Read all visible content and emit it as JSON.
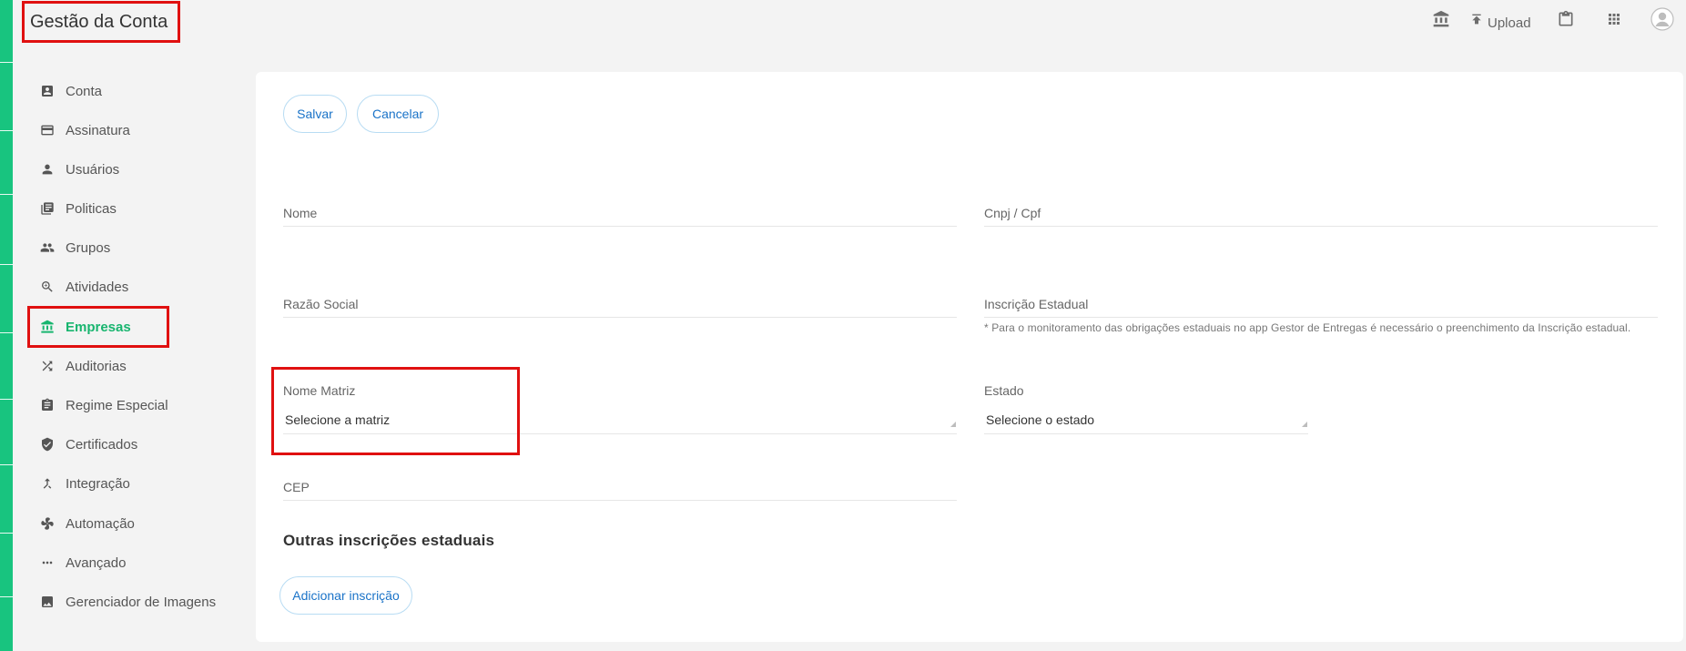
{
  "header": {
    "title": "Gestão da Conta",
    "upload_label": "Upload",
    "icons": [
      "bank-icon",
      "upload-icon",
      "clipboard-icon",
      "apps-icon",
      "avatar-icon"
    ]
  },
  "sidebar": {
    "items": [
      {
        "label": "Conta",
        "icon": "account-box-icon"
      },
      {
        "label": "Assinatura",
        "icon": "credit-card-icon"
      },
      {
        "label": "Usuários",
        "icon": "person-icon"
      },
      {
        "label": "Politicas",
        "icon": "library-books-icon"
      },
      {
        "label": "Grupos",
        "icon": "group-icon"
      },
      {
        "label": "Atividades",
        "icon": "zoom-in-icon"
      },
      {
        "label": "Empresas",
        "icon": "bank-icon",
        "active": true
      },
      {
        "label": "Auditorias",
        "icon": "shuffle-icon"
      },
      {
        "label": "Regime Especial",
        "icon": "assignment-icon"
      },
      {
        "label": "Certificados",
        "icon": "shield-check-icon"
      },
      {
        "label": "Integração",
        "icon": "merge-icon"
      },
      {
        "label": "Automação",
        "icon": "fan-icon"
      },
      {
        "label": "Avançado",
        "icon": "more-horiz-icon"
      },
      {
        "label": "Gerenciador de Imagens",
        "icon": "image-icon"
      }
    ]
  },
  "form": {
    "save_label": "Salvar",
    "cancel_label": "Cancelar",
    "nome_label": "Nome",
    "cnpj_label": "Cnpj / Cpf",
    "razao_label": "Razão Social",
    "inscricao_label": "Inscrição Estadual",
    "inscricao_note": "* Para o monitoramento das obrigações estaduais no app Gestor de Entregas é necessário o preenchimento da Inscrição estadual.",
    "matriz_label": "Nome Matriz",
    "matriz_value": "Selecione a matriz",
    "estado_label": "Estado",
    "estado_value": "Selecione o estado",
    "cep_label": "CEP",
    "outras_title": "Outras inscrições estaduais",
    "add_label": "Adicionar inscrição"
  },
  "colors": {
    "accent_green": "#18c47f",
    "link_blue": "#1a73c8",
    "highlight_red": "#e01010"
  }
}
